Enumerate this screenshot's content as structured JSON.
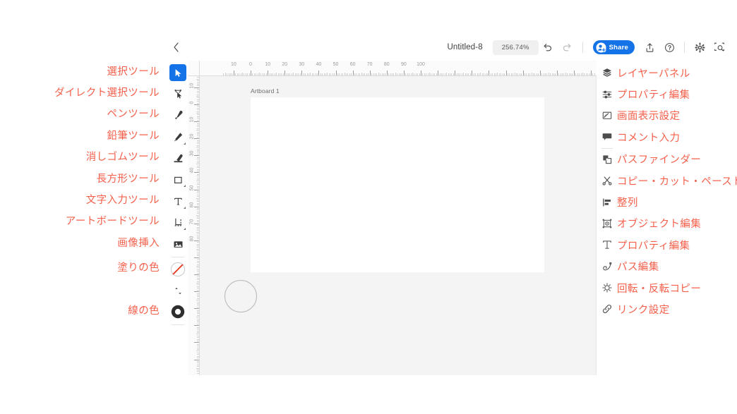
{
  "header": {
    "back_label": "‹",
    "document_title": "Untitled-8",
    "zoom_level": "256.74%",
    "undo_label": "Undo",
    "redo_label": "Redo",
    "share_label": "Share",
    "export_label": "Export",
    "help_label": "Help",
    "settings_label": "Settings",
    "preview_label": "Preview",
    "accent_color": "#1473e6"
  },
  "annotation": {
    "color": "#f4604b"
  },
  "toolbar": {
    "tools": [
      {
        "name": "selection-tool",
        "label": "選択ツール",
        "icon": "cursor-arrow-icon",
        "active": true,
        "has_flyout": false
      },
      {
        "name": "direct-selection-tool",
        "label": "ダイレクト選択ツール",
        "icon": "direct-select-icon",
        "active": false,
        "has_flyout": false
      },
      {
        "name": "pen-tool",
        "label": "ペンツール",
        "icon": "pen-icon",
        "active": false,
        "has_flyout": false
      },
      {
        "name": "pencil-tool",
        "label": "鉛筆ツール",
        "icon": "pencil-icon",
        "active": false,
        "has_flyout": true
      },
      {
        "name": "eraser-tool",
        "label": "消しゴムツール",
        "icon": "eraser-icon",
        "active": false,
        "has_flyout": false
      },
      {
        "name": "rectangle-tool",
        "label": "長方形ツール",
        "icon": "rectangle-icon",
        "active": false,
        "has_flyout": true
      },
      {
        "name": "type-tool",
        "label": "文字入力ツール",
        "icon": "type-t-icon",
        "active": false,
        "has_flyout": true
      },
      {
        "name": "artboard-tool",
        "label": "アートボードツール",
        "icon": "artboard-icon",
        "active": false,
        "has_flyout": true
      },
      {
        "name": "place-image-tool",
        "label": "画像挿入",
        "icon": "image-icon",
        "active": false,
        "has_flyout": false
      }
    ],
    "fill_label": "塗りの色",
    "fill_icon": "fill-none-swatch-icon",
    "swap_icon": "swap-fill-stroke-icon",
    "stroke_label": "線の色",
    "stroke_icon": "stroke-ring-swatch-icon"
  },
  "right_panel": {
    "items": [
      {
        "name": "layers-panel",
        "label": "レイヤーパネル",
        "icon": "layers-stack-icon"
      },
      {
        "name": "properties-panel",
        "label": "プロパティ編集",
        "icon": "sliders-icon"
      },
      {
        "name": "view-settings",
        "label": "画面表示設定",
        "icon": "ruler-view-icon"
      },
      {
        "name": "comments",
        "label": "コメント入力",
        "icon": "comment-bubble-icon"
      },
      {
        "name": "pathfinder",
        "label": "パスファインダー",
        "icon": "pathfinder-squares-icon"
      },
      {
        "name": "copy-cut-paste",
        "label": "コピー・カット・ペースト",
        "icon": "scissors-icon"
      },
      {
        "name": "align",
        "label": "整列",
        "icon": "align-left-icon"
      },
      {
        "name": "object-edit",
        "label": "オブジェクト編集",
        "icon": "object-transform-icon"
      },
      {
        "name": "text-properties",
        "label": "プロパティ編集",
        "icon": "type-properties-icon"
      },
      {
        "name": "path-edit",
        "label": "パス編集",
        "icon": "path-node-icon"
      },
      {
        "name": "rotate-reflect-copy",
        "label": "回転・反転コピー",
        "icon": "rotate-reflect-icon"
      },
      {
        "name": "link-settings",
        "label": "リンク設定",
        "icon": "link-chain-icon"
      }
    ],
    "divider_after_index": 3
  },
  "canvas": {
    "artboard_label": "Artboard 1",
    "background_color": "#f4f4f4",
    "artboard_color": "#ffffff",
    "shapes": [
      {
        "name": "ellipse-shape",
        "type": "circle",
        "stroke": "#b9b9b9",
        "fill": "none"
      }
    ],
    "ruler_h_labels": [
      "10",
      "0",
      "10",
      "20",
      "30",
      "40",
      "50",
      "60",
      "70",
      "80",
      "90",
      "100"
    ],
    "ruler_v_labels": [
      "10",
      "0",
      "10",
      "20",
      "30",
      "40",
      "50",
      "60",
      "70",
      "80"
    ]
  }
}
